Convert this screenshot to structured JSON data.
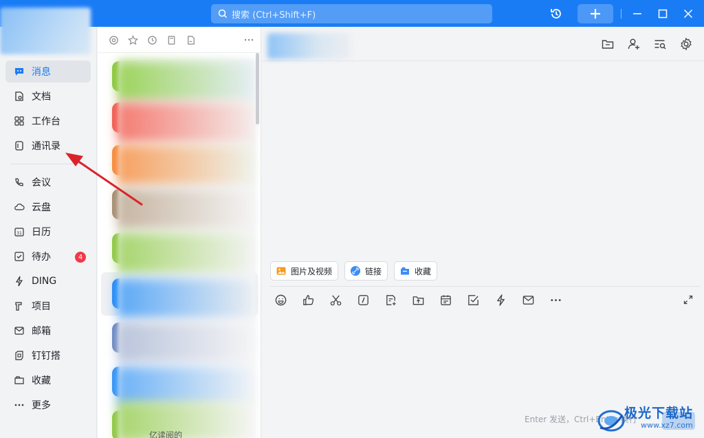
{
  "titlebar": {
    "search_placeholder": "搜索 (Ctrl+Shift+F)",
    "icons": [
      "history-icon",
      "plus-icon",
      "minimize-icon",
      "maximize-icon",
      "close-icon"
    ]
  },
  "sidebar": {
    "items": [
      {
        "label": "消息",
        "icon": "message-icon",
        "active": true
      },
      {
        "label": "文档",
        "icon": "document-icon"
      },
      {
        "label": "工作台",
        "icon": "grid-icon"
      },
      {
        "label": "通讯录",
        "icon": "contacts-icon"
      },
      {
        "label": "会议",
        "icon": "phone-icon"
      },
      {
        "label": "云盘",
        "icon": "cloud-icon"
      },
      {
        "label": "日历",
        "icon": "calendar-icon"
      },
      {
        "label": "待办",
        "icon": "checkbox-icon",
        "badge": "4"
      },
      {
        "label": "DING",
        "icon": "lightning-icon"
      },
      {
        "label": "项目",
        "icon": "project-icon"
      },
      {
        "label": "邮箱",
        "icon": "mail-icon"
      },
      {
        "label": "钉钉搭",
        "icon": "build-icon"
      },
      {
        "label": "收藏",
        "icon": "folder-icon"
      },
      {
        "label": "更多",
        "icon": "more-icon"
      }
    ]
  },
  "conversation_list": {
    "toolbar_icons": [
      "at-icon",
      "star-icon",
      "clock-icon",
      "bookmark-icon",
      "file-icon",
      "more-icon"
    ],
    "preview_text": "亿读阅的"
  },
  "chat": {
    "header_icons": [
      "folder-icon",
      "add-user-icon",
      "search-list-icon",
      "settings-icon"
    ],
    "quick_actions": [
      {
        "label": "图片及视频",
        "icon": "image-icon"
      },
      {
        "label": "链接",
        "icon": "link-icon"
      },
      {
        "label": "收藏",
        "icon": "collection-icon"
      }
    ],
    "tools": [
      "emoji-icon",
      "thumbs-up-icon",
      "scissors-icon",
      "slash-icon",
      "doc-plus-icon",
      "upload-icon",
      "calendar-icon",
      "task-icon",
      "ding-icon",
      "mail-icon",
      "more-icon",
      "expand-icon"
    ],
    "send_hint": "Enter 发送，Ctrl+Enter 换行"
  },
  "watermark": {
    "title": "极光下载站",
    "url": "www.xz7.com"
  },
  "colors": {
    "accent": "#1a7cf5",
    "badge": "#f2384a",
    "arrow": "#d9232c"
  }
}
